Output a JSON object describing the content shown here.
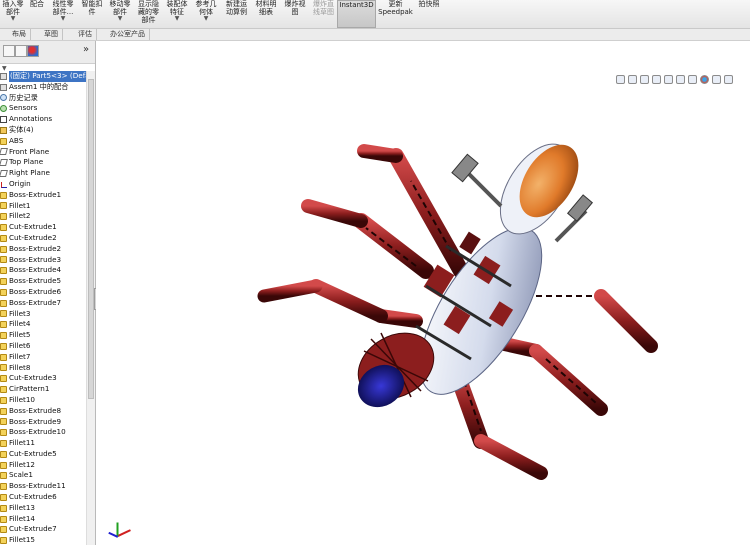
{
  "ribbon": {
    "buttons": [
      {
        "label": "插入零\n部件",
        "arrow": "▼"
      },
      {
        "label": "配合",
        "arrow": ""
      },
      {
        "label": "线性零\n部件...",
        "arrow": "▼"
      },
      {
        "label": "智能扣\n件",
        "arrow": ""
      },
      {
        "label": "移动零\n部件",
        "arrow": "▼"
      },
      {
        "label": "显示隐\n藏的零\n部件",
        "arrow": ""
      },
      {
        "label": "装配体\n特征",
        "arrow": "▼"
      },
      {
        "label": "参考几\n何体",
        "arrow": "▼"
      },
      {
        "label": "新建运\n动算例",
        "arrow": ""
      },
      {
        "label": "材料明\n细表",
        "arrow": ""
      },
      {
        "label": "爆炸视\n图",
        "arrow": ""
      },
      {
        "label": "爆炸直\n线草图",
        "arrow": ""
      },
      {
        "label": "Instant3D",
        "arrow": ""
      },
      {
        "label": "更新\nSpeedpak",
        "arrow": ""
      },
      {
        "label": "拍快照",
        "arrow": ""
      }
    ]
  },
  "tabs": [
    "布局",
    "草图",
    "评估",
    "办公室产品"
  ],
  "panel": {
    "expand_glyph": "»",
    "tree": [
      {
        "label": "(固定) Part5<3> (Defa",
        "icon": "mate",
        "selected": true
      },
      {
        "label": "Assem1 中的配合",
        "icon": "mate"
      },
      {
        "label": "历史记录",
        "icon": "hist"
      },
      {
        "label": "Sensors",
        "icon": "sensor"
      },
      {
        "label": "Annotations",
        "icon": "ann"
      },
      {
        "label": "实体(4)",
        "icon": "folder"
      },
      {
        "label": "ABS",
        "icon": "feat"
      },
      {
        "label": "Front Plane",
        "icon": "plane"
      },
      {
        "label": "Top Plane",
        "icon": "plane"
      },
      {
        "label": "Right Plane",
        "icon": "plane"
      },
      {
        "label": "Origin",
        "icon": "origin"
      },
      {
        "label": "Boss-Extrude1",
        "icon": "feat"
      },
      {
        "label": "Fillet1",
        "icon": "feat"
      },
      {
        "label": "Fillet2",
        "icon": "feat"
      },
      {
        "label": "Cut-Extrude1",
        "icon": "feat"
      },
      {
        "label": "Cut-Extrude2",
        "icon": "feat"
      },
      {
        "label": "Boss-Extrude2",
        "icon": "feat"
      },
      {
        "label": "Boss-Extrude3",
        "icon": "feat"
      },
      {
        "label": "Boss-Extrude4",
        "icon": "feat"
      },
      {
        "label": "Boss-Extrude5",
        "icon": "feat"
      },
      {
        "label": "Boss-Extrude6",
        "icon": "feat"
      },
      {
        "label": "Boss-Extrude7",
        "icon": "feat"
      },
      {
        "label": "Fillet3",
        "icon": "feat"
      },
      {
        "label": "Fillet4",
        "icon": "feat"
      },
      {
        "label": "Fillet5",
        "icon": "feat"
      },
      {
        "label": "Fillet6",
        "icon": "feat"
      },
      {
        "label": "Fillet7",
        "icon": "feat"
      },
      {
        "label": "Fillet8",
        "icon": "feat"
      },
      {
        "label": "Cut-Extrude3",
        "icon": "feat"
      },
      {
        "label": "CirPattern1",
        "icon": "feat"
      },
      {
        "label": "Fillet10",
        "icon": "feat"
      },
      {
        "label": "Boss-Extrude8",
        "icon": "feat"
      },
      {
        "label": "Boss-Extrude9",
        "icon": "feat"
      },
      {
        "label": "Boss-Extrude10",
        "icon": "feat"
      },
      {
        "label": "Fillet11",
        "icon": "feat"
      },
      {
        "label": "Cut-Extrude5",
        "icon": "feat"
      },
      {
        "label": "Fillet12",
        "icon": "feat"
      },
      {
        "label": "Scale1",
        "icon": "feat"
      },
      {
        "label": "Boss-Extrude11",
        "icon": "feat"
      },
      {
        "label": "Cut-Extrude6",
        "icon": "feat"
      },
      {
        "label": "Fillet13",
        "icon": "feat"
      },
      {
        "label": "Fillet14",
        "icon": "feat"
      },
      {
        "label": "Cut-Extrude7",
        "icon": "feat"
      },
      {
        "label": "Fillet15",
        "icon": "feat"
      }
    ]
  },
  "colors": {
    "selection": "#3d74c4",
    "body_white": "#e8ecf5",
    "leg_red": "#8c1e1e",
    "head_orange": "#e07a2a",
    "tail_blue": "#2626a8"
  },
  "view_tools": [
    "zoom-to-fit-icon",
    "zoom-area-icon",
    "previous-view-icon",
    "section-view-icon",
    "view-orientation-icon",
    "display-style-icon",
    "hide-show-icon",
    "edit-appearance-icon",
    "apply-scene-icon",
    "view-settings-icon"
  ]
}
